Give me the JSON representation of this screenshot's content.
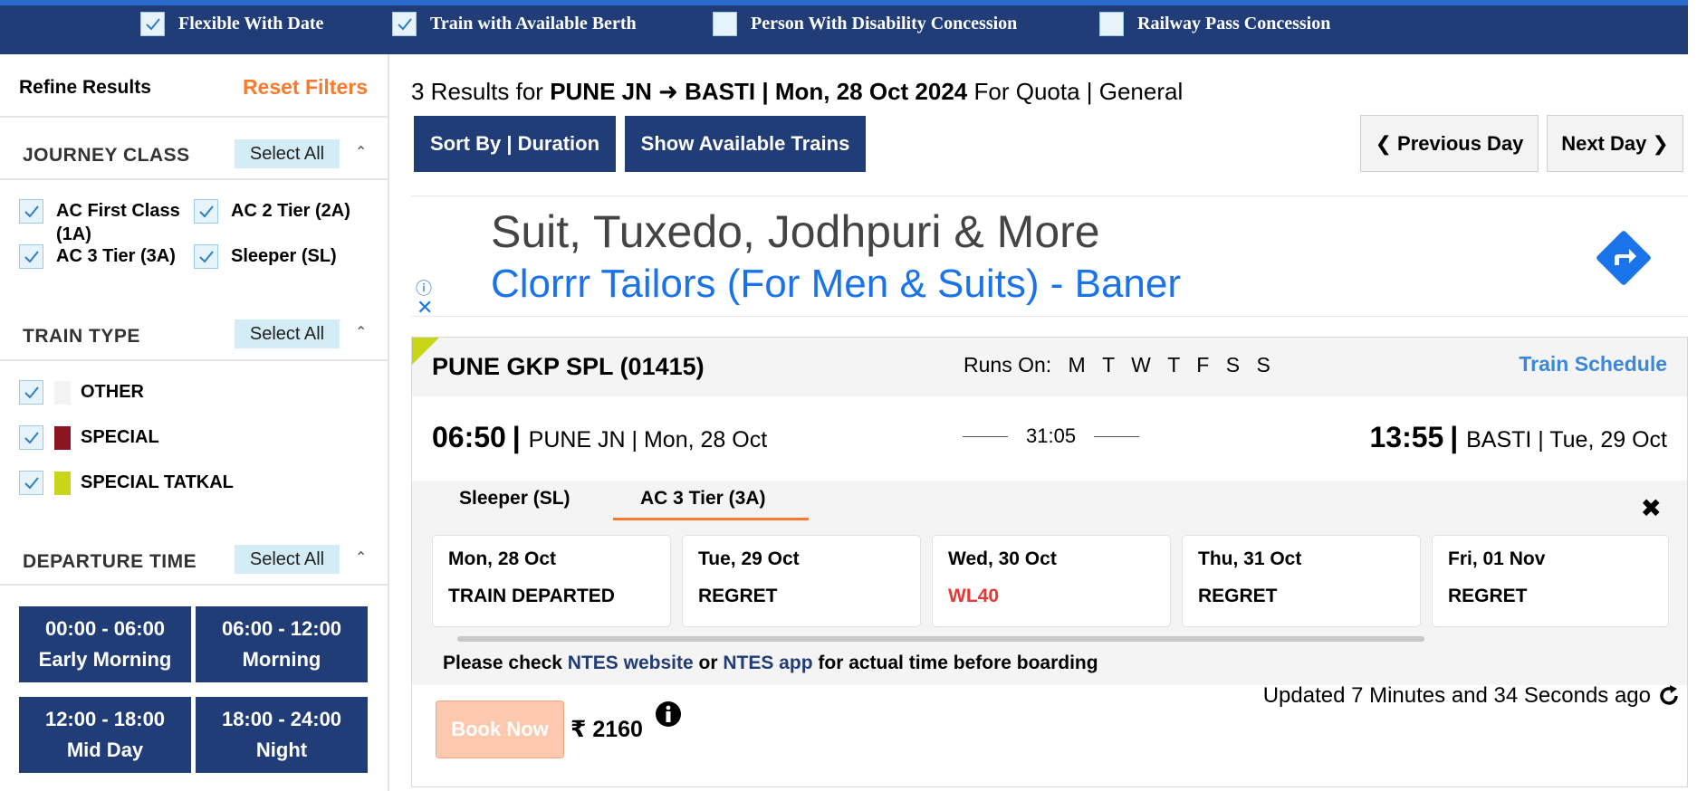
{
  "colors": {
    "navy": "#213d77",
    "accent_orange": "#fb792b",
    "link_blue": "#3d87d8",
    "wl_red": "#e53935",
    "special_swatch": "#8b1520",
    "tatkal_swatch": "#c9d617"
  },
  "top_options": [
    {
      "label": "Flexible With Date",
      "checked": true
    },
    {
      "label": "Train with Available Berth",
      "checked": true
    },
    {
      "label": "Person With Disability Concession",
      "checked": false
    },
    {
      "label": "Railway Pass Concession",
      "checked": false
    }
  ],
  "sidebar": {
    "refine": "Refine Results",
    "reset": "Reset Filters",
    "journey_class": {
      "title": "JOURNEY CLASS",
      "select_all": "Select All",
      "items": [
        "AC First Class (1A)",
        "AC 2 Tier (2A)",
        "AC 3 Tier (3A)",
        "Sleeper (SL)"
      ]
    },
    "train_type": {
      "title": "TRAIN TYPE",
      "select_all": "Select All",
      "items": [
        "OTHER",
        "SPECIAL",
        "SPECIAL TATKAL"
      ]
    },
    "departure_time": {
      "title": "DEPARTURE TIME",
      "select_all": "Select All",
      "slots": [
        {
          "range": "00:00 - 06:00",
          "name": "Early Morning"
        },
        {
          "range": "06:00 - 12:00",
          "name": "Morning"
        },
        {
          "range": "12:00 - 18:00",
          "name": "Mid Day"
        },
        {
          "range": "18:00 - 24:00",
          "name": "Night"
        }
      ]
    }
  },
  "results": {
    "count_prefix": "3 Results for",
    "route": "PUNE JN ➜ BASTI | Mon, 28 Oct 2024",
    "quota": "For Quota | General",
    "sort_btn": "Sort By | Duration",
    "avail_btn": "Show Available Trains",
    "prev_day": "Previous Day",
    "next_day": "Next Day"
  },
  "ad": {
    "headline": "Suit, Tuxedo, Jodhpuri & More",
    "subline": "Clorrr Tailors (For Men & Suits) - Baner"
  },
  "train": {
    "name": "PUNE GKP SPL (01415)",
    "runs_on_label": "Runs On:",
    "days": [
      "M",
      "T",
      "W",
      "T",
      "F",
      "S",
      "S"
    ],
    "schedule_link": "Train Schedule",
    "dep_time": "06:50",
    "dep_info": "PUNE JN | Mon, 28 Oct",
    "duration": "31:05",
    "arr_time": "13:55",
    "arr_info": "BASTI | Tue, 29 Oct",
    "tabs": [
      "Sleeper (SL)",
      "AC 3 Tier (3A)"
    ],
    "active_tab": "AC 3 Tier (3A)",
    "availability": [
      {
        "date": "Mon, 28 Oct",
        "status": "TRAIN DEPARTED"
      },
      {
        "date": "Tue, 29 Oct",
        "status": "REGRET"
      },
      {
        "date": "Wed, 30 Oct",
        "status": "WL40"
      },
      {
        "date": "Thu, 31 Oct",
        "status": "REGRET"
      },
      {
        "date": "Fri, 01 Nov",
        "status": "REGRET"
      }
    ],
    "ntes_note": {
      "a": "Please check",
      "link1": "NTES website",
      "b": "or",
      "link2": "NTES app",
      "c": "for actual time before boarding"
    },
    "updated": "Updated 7 Minutes and 34 Seconds ago",
    "book_now": "Book Now",
    "price": "₹ 2160"
  }
}
